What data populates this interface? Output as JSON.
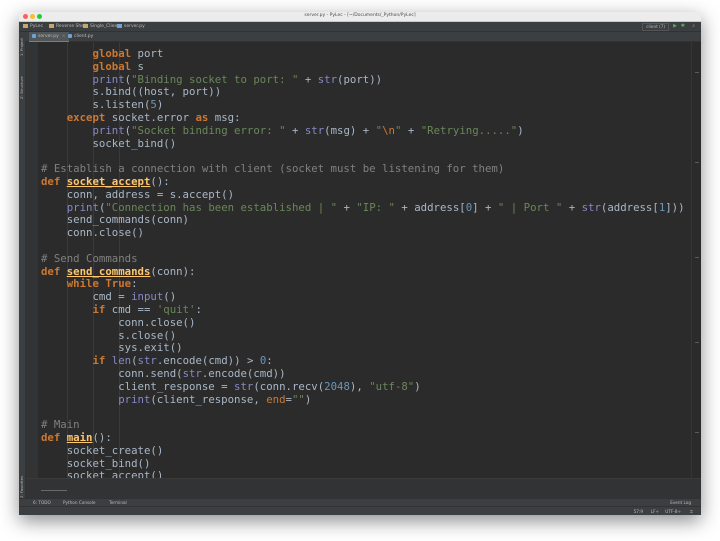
{
  "window": {
    "title": "server.py - PyLec - [~/Documents/_Python/PyLec]"
  },
  "navbar": {
    "breadcrumbs": [
      "PyLec",
      "Reverse Shell",
      "Single_Client",
      "server.py"
    ],
    "run_config": "client (7)"
  },
  "tabs": [
    {
      "label": "server.py",
      "active": true
    },
    {
      "label": "client.py",
      "active": false
    }
  ],
  "left_tool_windows": [
    "1: Project",
    "Z: Structure"
  ],
  "left_favorites": "2: Favorites",
  "bottom_tools": {
    "todo": "6: TODO",
    "python_console": "Python Console",
    "terminal": "Terminal",
    "event_log": "Event Log"
  },
  "status": {
    "position": "57:9",
    "line_separator": "LF÷",
    "encoding": "UTF-8÷"
  },
  "colors": {
    "keyword": "#cc7832",
    "function": "#ffc66d",
    "builtin": "#8888c6",
    "string": "#6a8759",
    "number": "#6897bb",
    "comment": "#808080",
    "default": "#a9b7c6",
    "background": "#2b2b2b"
  },
  "code_lines": [
    [
      {
        "t": "        "
      },
      {
        "t": "global",
        "c": "kw"
      },
      {
        "t": " port"
      }
    ],
    [
      {
        "t": "        "
      },
      {
        "t": "global",
        "c": "kw"
      },
      {
        "t": " s"
      }
    ],
    [
      {
        "t": "        "
      },
      {
        "t": "print",
        "c": "bi"
      },
      {
        "t": "("
      },
      {
        "t": "\"Binding socket to port: \"",
        "c": "st"
      },
      {
        "t": " + "
      },
      {
        "t": "str",
        "c": "bi"
      },
      {
        "t": "(port))"
      }
    ],
    [
      {
        "t": "        s.bind((host, port))"
      }
    ],
    [
      {
        "t": "        s.listen("
      },
      {
        "t": "5",
        "c": "nm"
      },
      {
        "t": ")"
      }
    ],
    [
      {
        "t": "    "
      },
      {
        "t": "except",
        "c": "kw"
      },
      {
        "t": " socket.error "
      },
      {
        "t": "as",
        "c": "kw"
      },
      {
        "t": " msg:"
      }
    ],
    [
      {
        "t": "        "
      },
      {
        "t": "print",
        "c": "bi"
      },
      {
        "t": "("
      },
      {
        "t": "\"Socket binding error: \"",
        "c": "st"
      },
      {
        "t": " + "
      },
      {
        "t": "str",
        "c": "bi"
      },
      {
        "t": "(msg) + "
      },
      {
        "t": "\"",
        "c": "st"
      },
      {
        "t": "\\n",
        "c": "esc"
      },
      {
        "t": "\"",
        "c": "st"
      },
      {
        "t": " + "
      },
      {
        "t": "\"Retrying.....\"",
        "c": "st"
      },
      {
        "t": ")"
      }
    ],
    [
      {
        "t": "        socket_bind()"
      }
    ],
    [],
    [
      {
        "t": "# Establish a connection with client (socket must be listening for them)",
        "c": "cm"
      }
    ],
    [
      {
        "t": "def",
        "c": "kw"
      },
      {
        "t": " "
      },
      {
        "t": "socket_accept",
        "c": "fn"
      },
      {
        "t": "():"
      }
    ],
    [
      {
        "t": "    conn, address = s.accept()"
      }
    ],
    [
      {
        "t": "    "
      },
      {
        "t": "print",
        "c": "bi"
      },
      {
        "t": "("
      },
      {
        "t": "\"Connection has been established | \"",
        "c": "st"
      },
      {
        "t": " + "
      },
      {
        "t": "\"IP: \"",
        "c": "st"
      },
      {
        "t": " + address["
      },
      {
        "t": "0",
        "c": "nm"
      },
      {
        "t": "] + "
      },
      {
        "t": "\" | Port \"",
        "c": "st"
      },
      {
        "t": " + "
      },
      {
        "t": "str",
        "c": "bi"
      },
      {
        "t": "(address["
      },
      {
        "t": "1",
        "c": "nm"
      },
      {
        "t": "]))"
      }
    ],
    [
      {
        "t": "    send_commands(conn)"
      }
    ],
    [
      {
        "t": "    conn.close()"
      }
    ],
    [],
    [
      {
        "t": "# Send Commands",
        "c": "cm"
      }
    ],
    [
      {
        "t": "def",
        "c": "kw"
      },
      {
        "t": " "
      },
      {
        "t": "send_commands",
        "c": "fn"
      },
      {
        "t": "(conn):"
      }
    ],
    [
      {
        "t": "    "
      },
      {
        "t": "while",
        "c": "kw"
      },
      {
        "t": " "
      },
      {
        "t": "True",
        "c": "kw"
      },
      {
        "t": ":"
      }
    ],
    [
      {
        "t": "        cmd = "
      },
      {
        "t": "input",
        "c": "bi"
      },
      {
        "t": "()"
      }
    ],
    [
      {
        "t": "        "
      },
      {
        "t": "if",
        "c": "kw"
      },
      {
        "t": " cmd == "
      },
      {
        "t": "'quit'",
        "c": "st"
      },
      {
        "t": ":"
      }
    ],
    [
      {
        "t": "            conn.close()"
      }
    ],
    [
      {
        "t": "            s.close()"
      }
    ],
    [
      {
        "t": "            sys.exit()"
      }
    ],
    [
      {
        "t": "        "
      },
      {
        "t": "if",
        "c": "kw"
      },
      {
        "t": " "
      },
      {
        "t": "len",
        "c": "bi"
      },
      {
        "t": "("
      },
      {
        "t": "str",
        "c": "bi"
      },
      {
        "t": ".encode(cmd)) > "
      },
      {
        "t": "0",
        "c": "nm"
      },
      {
        "t": ":"
      }
    ],
    [
      {
        "t": "            conn.send("
      },
      {
        "t": "str",
        "c": "bi"
      },
      {
        "t": ".encode(cmd))"
      }
    ],
    [
      {
        "t": "            client_response = "
      },
      {
        "t": "str",
        "c": "bi"
      },
      {
        "t": "(conn.recv("
      },
      {
        "t": "2048",
        "c": "nm"
      },
      {
        "t": "), "
      },
      {
        "t": "\"utf-8\"",
        "c": "st"
      },
      {
        "t": ")"
      }
    ],
    [
      {
        "t": "            "
      },
      {
        "t": "print",
        "c": "bi"
      },
      {
        "t": "(client_response, "
      },
      {
        "t": "end",
        "c": "esc"
      },
      {
        "t": "="
      },
      {
        "t": "\"\"",
        "c": "st"
      },
      {
        "t": ")"
      }
    ],
    [],
    [
      {
        "t": "# Main",
        "c": "cm"
      }
    ],
    [
      {
        "t": "def",
        "c": "kw"
      },
      {
        "t": " "
      },
      {
        "t": "main",
        "c": "fn"
      },
      {
        "t": "():"
      }
    ],
    [
      {
        "t": "    socket_create()"
      }
    ],
    [
      {
        "t": "    socket_bind()"
      }
    ],
    [
      {
        "t": "    socket_accept()"
      }
    ]
  ]
}
